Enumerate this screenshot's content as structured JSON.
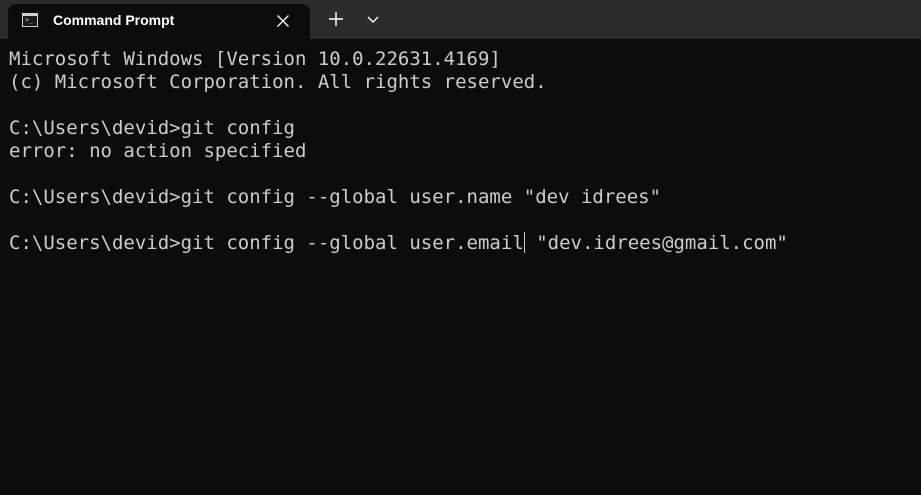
{
  "window": {
    "tab_title": "Command Prompt",
    "icons": {
      "tab": "command-prompt-icon",
      "close": "close-icon",
      "new_tab": "plus-icon",
      "dropdown": "chevron-down-icon"
    }
  },
  "terminal": {
    "lines": [
      "Microsoft Windows [Version 10.0.22631.4169]",
      "(c) Microsoft Corporation. All rights reserved.",
      "C:\\Users\\devid>git config",
      "error: no action specified",
      "C:\\Users\\devid>git config --global user.name \"dev idrees\""
    ],
    "current_input_before_caret": "C:\\Users\\devid>git config --global user.email",
    "current_input_after_caret": " \"dev.idrees@gmail.com\""
  },
  "colors": {
    "background": "#0c0c0c",
    "tabbar": "#2b2b2b",
    "text": "#cccccc"
  }
}
